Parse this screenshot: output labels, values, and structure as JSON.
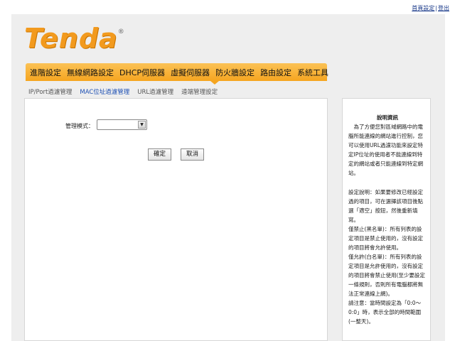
{
  "top_links": {
    "home": "首頁設定",
    "sep": "|",
    "logout": "登出"
  },
  "brand": {
    "logo_text": "Tenda",
    "registered": "®",
    "accent": "#f29a1e"
  },
  "nav": {
    "items": [
      "進階設定",
      "無線網路設定",
      "DHCP伺服器",
      "虛擬伺服器",
      "防火牆設定",
      "路由設定",
      "系統工具"
    ]
  },
  "subtabs": {
    "items": [
      "IP/Port過濾管理",
      "MAC位址過濾管理",
      "URL過濾管理",
      "遠端管理設定"
    ],
    "active_index": 1
  },
  "form": {
    "mode_label": "管理模式：",
    "mode_value": "",
    "ok_label": "確定",
    "cancel_label": "取消"
  },
  "help": {
    "title": "說明資訊",
    "intro": "　為了方便您對區域網路中的電腦所能連線的網站進行控制，您可以使用URL過濾功能來設定特定IP位址的使用者不能連線到特定的網站或者只能連線到特定網站。",
    "settings": "設定說明：如果要修改已經設定過的項目，可在選擇該項目後點選「適空」按鈕，然後重新填寫。",
    "deny": "僅禁止(黑名單)：所有列表的設定項目是禁止使用的，沒有設定的項目將會允許使用。",
    "allow": "僅允許(白名單)：所有列表的設定項目是允許使用的，沒有設定的項目將會禁止使用(至少要設定一條規則，否則所有電腦都將無法正常連線上網)。",
    "note": "請注意：當時間設定為「0:0～0:0」時，表示全部的時間範圍(一整天)。"
  }
}
